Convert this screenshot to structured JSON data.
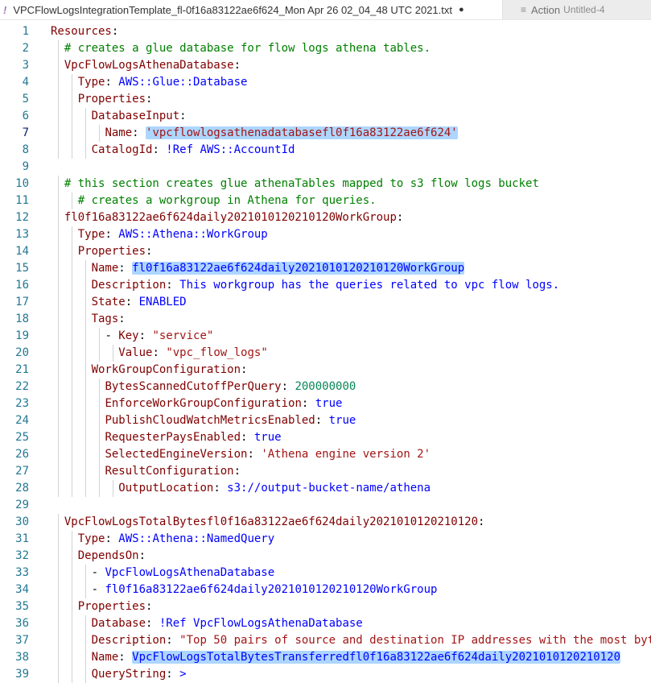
{
  "tabs": [
    {
      "modified_icon": "!",
      "label": "VPCFlowLogsIntegrationTemplate_fl-0f16a83122ae6f624_Mon Apr 26 02_04_48 UTC 2021.txt",
      "dirty_dot": "●",
      "active": true
    },
    {
      "icon": "lines-icon",
      "label": "Action",
      "sub": "Untitled-4",
      "active": false
    }
  ],
  "colors": {
    "key": "#800000",
    "string": "#a31515",
    "value": "#0000ff",
    "number": "#098658",
    "comment": "#008000",
    "line_number": "#237893",
    "selection": "#add6ff"
  },
  "current_line": 7,
  "editor": {
    "lines": [
      {
        "no": "1",
        "segs": [
          {
            "t": "Resources",
            "c": "k"
          },
          {
            "t": ":",
            "c": "p"
          }
        ]
      },
      {
        "no": "2",
        "segs": [
          {
            "t": "  "
          },
          {
            "t": "# creates a glue database for flow logs athena tables.",
            "c": "c"
          }
        ]
      },
      {
        "no": "3",
        "segs": [
          {
            "t": "  "
          },
          {
            "t": "VpcFlowLogsAthenaDatabase",
            "c": "k"
          },
          {
            "t": ":",
            "c": "p"
          }
        ]
      },
      {
        "no": "4",
        "segs": [
          {
            "t": "    "
          },
          {
            "t": "Type",
            "c": "k"
          },
          {
            "t": ": ",
            "c": "p"
          },
          {
            "t": "AWS::Glue::Database",
            "c": "v"
          }
        ]
      },
      {
        "no": "5",
        "segs": [
          {
            "t": "    "
          },
          {
            "t": "Properties",
            "c": "k"
          },
          {
            "t": ":",
            "c": "p"
          }
        ]
      },
      {
        "no": "6",
        "segs": [
          {
            "t": "      "
          },
          {
            "t": "DatabaseInput",
            "c": "k"
          },
          {
            "t": ":",
            "c": "p"
          }
        ]
      },
      {
        "no": "7",
        "segs": [
          {
            "t": "        "
          },
          {
            "t": "Name",
            "c": "k"
          },
          {
            "t": ": ",
            "c": "p"
          },
          {
            "t": "'vpcflowlogsathenadatabasefl0f16a83122ae6f624'",
            "c": "s",
            "hl": true
          }
        ]
      },
      {
        "no": "8",
        "segs": [
          {
            "t": "      "
          },
          {
            "t": "CatalogId",
            "c": "k"
          },
          {
            "t": ": ",
            "c": "p"
          },
          {
            "t": "!Ref AWS::AccountId",
            "c": "v"
          }
        ]
      },
      {
        "no": "9",
        "segs": []
      },
      {
        "no": "10",
        "segs": [
          {
            "t": "  "
          },
          {
            "t": "# this section creates glue athenaTables mapped to s3 flow logs bucket",
            "c": "c"
          }
        ]
      },
      {
        "no": "11",
        "segs": [
          {
            "t": "    "
          },
          {
            "t": "# creates a workgroup in Athena for queries.",
            "c": "c"
          }
        ]
      },
      {
        "no": "12",
        "segs": [
          {
            "t": "  "
          },
          {
            "t": "fl0f16a83122ae6f624daily2021010120210120WorkGroup",
            "c": "k"
          },
          {
            "t": ":",
            "c": "p"
          }
        ]
      },
      {
        "no": "13",
        "segs": [
          {
            "t": "    "
          },
          {
            "t": "Type",
            "c": "k"
          },
          {
            "t": ": ",
            "c": "p"
          },
          {
            "t": "AWS::Athena::WorkGroup",
            "c": "v"
          }
        ]
      },
      {
        "no": "14",
        "segs": [
          {
            "t": "    "
          },
          {
            "t": "Properties",
            "c": "k"
          },
          {
            "t": ":",
            "c": "p"
          }
        ]
      },
      {
        "no": "15",
        "segs": [
          {
            "t": "      "
          },
          {
            "t": "Name",
            "c": "k"
          },
          {
            "t": ": ",
            "c": "p"
          },
          {
            "t": "fl0f16a83122ae6f624daily2021010120210120WorkGroup",
            "c": "v",
            "hl": true
          }
        ]
      },
      {
        "no": "16",
        "segs": [
          {
            "t": "      "
          },
          {
            "t": "Description",
            "c": "k"
          },
          {
            "t": ": ",
            "c": "p"
          },
          {
            "t": "This workgroup has the queries related to vpc flow logs.",
            "c": "v"
          }
        ]
      },
      {
        "no": "17",
        "segs": [
          {
            "t": "      "
          },
          {
            "t": "State",
            "c": "k"
          },
          {
            "t": ": ",
            "c": "p"
          },
          {
            "t": "ENABLED",
            "c": "v"
          }
        ]
      },
      {
        "no": "18",
        "segs": [
          {
            "t": "      "
          },
          {
            "t": "Tags",
            "c": "k"
          },
          {
            "t": ":",
            "c": "p"
          }
        ]
      },
      {
        "no": "19",
        "segs": [
          {
            "t": "        "
          },
          {
            "t": "- ",
            "c": "p"
          },
          {
            "t": "Key",
            "c": "k"
          },
          {
            "t": ": ",
            "c": "p"
          },
          {
            "t": "\"service\"",
            "c": "s"
          }
        ]
      },
      {
        "no": "20",
        "segs": [
          {
            "t": "          "
          },
          {
            "t": "Value",
            "c": "k"
          },
          {
            "t": ": ",
            "c": "p"
          },
          {
            "t": "\"vpc_flow_logs\"",
            "c": "s"
          }
        ]
      },
      {
        "no": "21",
        "segs": [
          {
            "t": "      "
          },
          {
            "t": "WorkGroupConfiguration",
            "c": "k"
          },
          {
            "t": ":",
            "c": "p"
          }
        ]
      },
      {
        "no": "22",
        "segs": [
          {
            "t": "        "
          },
          {
            "t": "BytesScannedCutoffPerQuery",
            "c": "k"
          },
          {
            "t": ": ",
            "c": "p"
          },
          {
            "t": "200000000",
            "c": "n"
          }
        ]
      },
      {
        "no": "23",
        "segs": [
          {
            "t": "        "
          },
          {
            "t": "EnforceWorkGroupConfiguration",
            "c": "k"
          },
          {
            "t": ": ",
            "c": "p"
          },
          {
            "t": "true",
            "c": "v"
          }
        ]
      },
      {
        "no": "24",
        "segs": [
          {
            "t": "        "
          },
          {
            "t": "PublishCloudWatchMetricsEnabled",
            "c": "k"
          },
          {
            "t": ": ",
            "c": "p"
          },
          {
            "t": "true",
            "c": "v"
          }
        ]
      },
      {
        "no": "25",
        "segs": [
          {
            "t": "        "
          },
          {
            "t": "RequesterPaysEnabled",
            "c": "k"
          },
          {
            "t": ": ",
            "c": "p"
          },
          {
            "t": "true",
            "c": "v"
          }
        ]
      },
      {
        "no": "26",
        "segs": [
          {
            "t": "        "
          },
          {
            "t": "SelectedEngineVersion",
            "c": "k"
          },
          {
            "t": ": ",
            "c": "p"
          },
          {
            "t": "'Athena engine version 2'",
            "c": "s"
          }
        ]
      },
      {
        "no": "27",
        "segs": [
          {
            "t": "        "
          },
          {
            "t": "ResultConfiguration",
            "c": "k"
          },
          {
            "t": ":",
            "c": "p"
          }
        ]
      },
      {
        "no": "28",
        "segs": [
          {
            "t": "          "
          },
          {
            "t": "OutputLocation",
            "c": "k"
          },
          {
            "t": ": ",
            "c": "p"
          },
          {
            "t": "s3://output-bucket-name/athena",
            "c": "v"
          }
        ]
      },
      {
        "no": "29",
        "segs": []
      },
      {
        "no": "30",
        "segs": [
          {
            "t": "  "
          },
          {
            "t": "VpcFlowLogsTotalBytesfl0f16a83122ae6f624daily2021010120210120",
            "c": "k"
          },
          {
            "t": ":",
            "c": "p"
          }
        ]
      },
      {
        "no": "31",
        "segs": [
          {
            "t": "    "
          },
          {
            "t": "Type",
            "c": "k"
          },
          {
            "t": ": ",
            "c": "p"
          },
          {
            "t": "AWS::Athena::NamedQuery",
            "c": "v"
          }
        ]
      },
      {
        "no": "32",
        "segs": [
          {
            "t": "    "
          },
          {
            "t": "DependsOn",
            "c": "k"
          },
          {
            "t": ":",
            "c": "p"
          }
        ]
      },
      {
        "no": "33",
        "segs": [
          {
            "t": "      "
          },
          {
            "t": "- ",
            "c": "p"
          },
          {
            "t": "VpcFlowLogsAthenaDatabase",
            "c": "v"
          }
        ]
      },
      {
        "no": "34",
        "segs": [
          {
            "t": "      "
          },
          {
            "t": "- ",
            "c": "p"
          },
          {
            "t": "fl0f16a83122ae6f624daily2021010120210120WorkGroup",
            "c": "v"
          }
        ]
      },
      {
        "no": "35",
        "segs": [
          {
            "t": "    "
          },
          {
            "t": "Properties",
            "c": "k"
          },
          {
            "t": ":",
            "c": "p"
          }
        ]
      },
      {
        "no": "36",
        "segs": [
          {
            "t": "      "
          },
          {
            "t": "Database",
            "c": "k"
          },
          {
            "t": ": ",
            "c": "p"
          },
          {
            "t": "!Ref VpcFlowLogsAthenaDatabase",
            "c": "v"
          }
        ]
      },
      {
        "no": "37",
        "segs": [
          {
            "t": "      "
          },
          {
            "t": "Description",
            "c": "k"
          },
          {
            "t": ": ",
            "c": "p"
          },
          {
            "t": "\"Top 50 pairs of source and destination IP addresses with the most byt",
            "c": "s"
          }
        ]
      },
      {
        "no": "38",
        "segs": [
          {
            "t": "      "
          },
          {
            "t": "Name",
            "c": "k"
          },
          {
            "t": ": ",
            "c": "p"
          },
          {
            "t": "VpcFlowLogsTotalBytesTransferredfl0f16a83122ae6f624daily2021010120210120",
            "c": "v",
            "hl": true
          }
        ]
      },
      {
        "no": "39",
        "segs": [
          {
            "t": "      "
          },
          {
            "t": "QueryString",
            "c": "k"
          },
          {
            "t": ": ",
            "c": "p"
          },
          {
            "t": ">",
            "c": "v"
          }
        ]
      }
    ]
  }
}
